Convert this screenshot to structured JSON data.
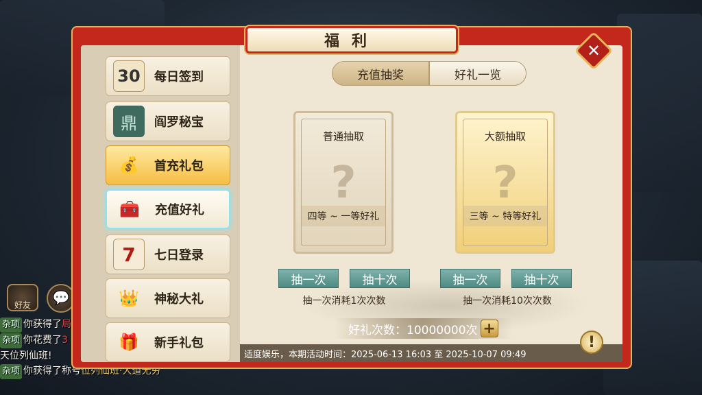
{
  "title": "福利",
  "close_label": "✕",
  "menu": [
    {
      "label": "每日签到",
      "icon": "calendar-check-icon",
      "glyph": "30"
    },
    {
      "label": "阎罗秘宝",
      "icon": "bronze-cauldron-icon",
      "glyph": "鼎"
    },
    {
      "label": "首充礼包",
      "icon": "gold-bag-icon",
      "glyph": "💰"
    },
    {
      "label": "充值好礼",
      "icon": "treasure-chest-icon",
      "glyph": "🧰"
    },
    {
      "label": "七日登录",
      "icon": "calendar-seven-icon",
      "glyph": "7"
    },
    {
      "label": "神秘大礼",
      "icon": "gold-chest-icon",
      "glyph": "👑"
    },
    {
      "label": "新手礼包",
      "icon": "gift-box-icon",
      "glyph": "🎁"
    }
  ],
  "tabs": {
    "active": "充值抽奖",
    "other": "好礼一览"
  },
  "cards": {
    "normal": {
      "title": "普通抽取",
      "range": "四等 ~ 一等好礼",
      "q": "?"
    },
    "big": {
      "title": "大额抽取",
      "range": "三等 ~ 特等好礼",
      "q": "?"
    }
  },
  "buttons": {
    "once": "抽一次",
    "ten": "抽十次"
  },
  "cost": {
    "normal": "抽一次消耗1次次数",
    "big": "抽一次消耗10次次数"
  },
  "count_label": "好礼次数：10000000次",
  "plus": "+",
  "help": "!",
  "notice": "适度娱乐，本期活动时间：2025-06-13 16:03 至 2025-10-07 09:49",
  "chat": {
    "friend": "好友",
    "tag": "杂项",
    "line1": "你获得了",
    "line1b": "局",
    "line2": "你花费了",
    "line2b": "3",
    "line3": "天位列仙班!",
    "line4": "你获得了称号",
    "line4b": "位列仙班·大道无穷"
  },
  "colors": {
    "frame": "#c4271c",
    "accent": "#e2b460",
    "draw_button": "#5d9891"
  }
}
